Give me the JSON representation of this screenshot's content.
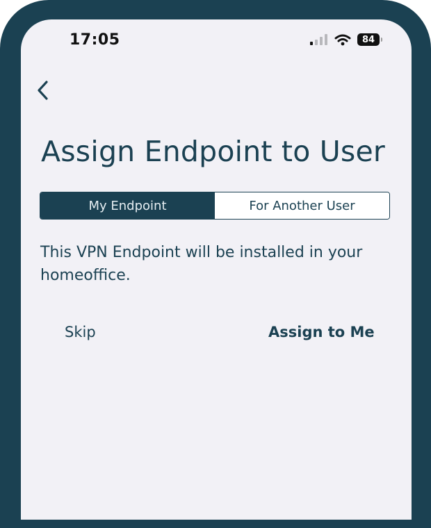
{
  "status_bar": {
    "time": "17:05",
    "battery_level": "84"
  },
  "navigation": {
    "back_icon": "chevron-left-icon"
  },
  "page": {
    "title": "Assign Endpoint to User"
  },
  "segmented_control": {
    "options": [
      {
        "label": "My Endpoint",
        "selected": true
      },
      {
        "label": "For Another User",
        "selected": false
      }
    ]
  },
  "description": "This VPN Endpoint will be installed in your homeoffice.",
  "actions": {
    "skip_label": "Skip",
    "assign_label": "Assign to Me"
  },
  "colors": {
    "frame": "#1b4152",
    "background": "#f2f1f6",
    "accent": "#1b4152",
    "segment_active_text": "#e6eef2"
  }
}
